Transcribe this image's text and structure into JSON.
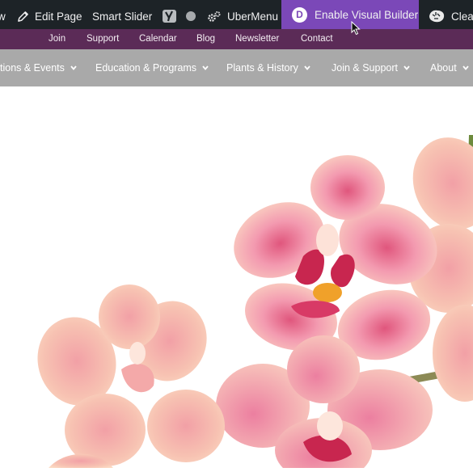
{
  "admin_bar": {
    "edge_glyph": "w",
    "edit_page": "Edit Page",
    "smart_slider": "Smart Slider",
    "ubermenu": "UberMenu",
    "enable_visual_builder": "Enable Visual Builder",
    "visual_builder_badge": "D",
    "clear": "Clea"
  },
  "top_nav": [
    "Join",
    "Support",
    "Calendar",
    "Blog",
    "Newsletter",
    "Contact"
  ],
  "main_nav": [
    "tions & Events",
    "Education & Programs",
    "Plants & History",
    "Join & Support",
    "About"
  ],
  "colors": {
    "admin_bar": "#1d2327",
    "visual_builder": "#7b48b8",
    "top_nav": "#5b2b57",
    "main_nav": "#a9a9a9"
  },
  "icons": [
    "pencil-icon",
    "yoast-icon",
    "status-dot-icon",
    "gears-icon",
    "divi-icon",
    "lion-icon",
    "chevron-down-icon",
    "cursor-icon"
  ]
}
